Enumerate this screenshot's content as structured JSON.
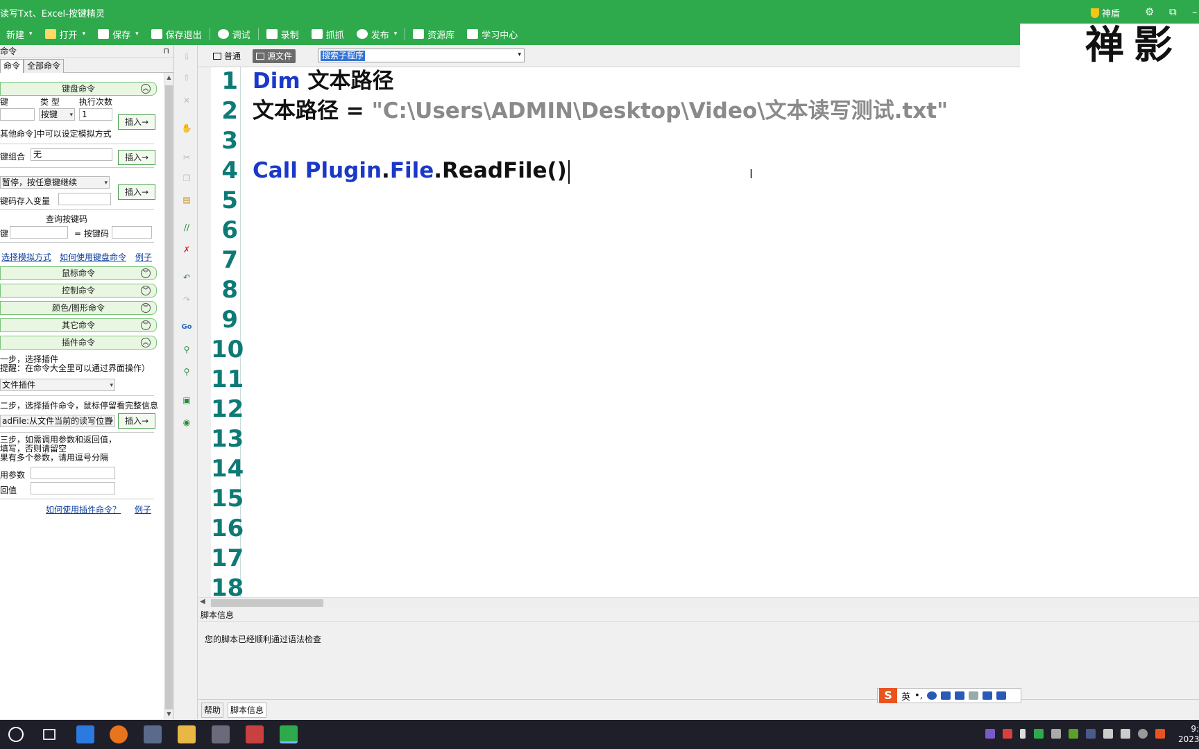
{
  "titlebar": {
    "title": "读写Txt、Excel-按键精灵",
    "shield": "神盾",
    "controls": [
      "⚙",
      "⧉",
      "–"
    ]
  },
  "toolbar": {
    "items": [
      {
        "label": "新建",
        "caret": "▾"
      },
      {
        "label": "打开",
        "caret": "▾"
      },
      {
        "label": "保存",
        "caret": "▾"
      },
      {
        "label": "保存退出"
      },
      {
        "label": "调试"
      },
      {
        "label": "录制"
      },
      {
        "label": "抓抓"
      },
      {
        "label": "发布",
        "caret": "▾"
      },
      {
        "label": "资源库"
      },
      {
        "label": "学习中心"
      }
    ]
  },
  "left": {
    "header": "命令",
    "pin": "⊓",
    "tabs": [
      "命令",
      "全部命令"
    ],
    "keyboard": {
      "title": "键盘命令",
      "col_key": "键",
      "col_type": "类 型",
      "col_count": "执行次数",
      "type_value": "按键",
      "count_value": "1",
      "insert": "插入→",
      "hint": "其他命令]中可以设定模拟方式",
      "combo_label": "键组合",
      "combo_value": "无",
      "pause_value": "暂停，按任意键继续",
      "store_label": "键码存入变量",
      "query_title": "查询按键码",
      "query_key": "键",
      "query_code": "= 按键码",
      "link1": "选择模拟方式",
      "link2": "如何使用键盘命令",
      "link3": "例子"
    },
    "sections": [
      "鼠标命令",
      "控制命令",
      "颜色/图形命令",
      "其它命令",
      "插件命令"
    ],
    "plugin": {
      "step1": "一步，选择插件",
      "step1_hint": "提醒：在命令大全里可以通过界面操作）",
      "plugin_value": "文件插件",
      "step2": "二步，选择插件命令，鼠标停留看完整信息",
      "cmd_value": "adFile:从文件当前的读写位置",
      "insert": "插入→",
      "step3a": "三步，如需调用参数和返回值，",
      "step3b": "填写，否则请留空",
      "step3c": "果有多个参数，请用逗号分隔",
      "param_label": "用参数",
      "ret_label": "回值",
      "link1": "如何使用插件命令？",
      "link2": "例子"
    }
  },
  "editor": {
    "view_normal": "普通",
    "view_source": "源文件",
    "sub_placeholder": "搜索子程序",
    "watermark": "禅影",
    "line_numbers": [
      "1",
      "2",
      "3",
      "4",
      "5",
      "6",
      "7",
      "8",
      "9",
      "10",
      "11",
      "12",
      "13",
      "14",
      "15",
      "16",
      "17",
      "18"
    ],
    "lines": [
      {
        "kw": "Dim",
        "rest": " 文本路径"
      },
      {
        "plain": "文本路径 = ",
        "str": "\"C:\\Users\\ADMIN\\Desktop\\Video\\文本读写测试.txt\""
      },
      {},
      {
        "kw": "Call",
        "kw2": "Plugin",
        "dot1": ".",
        "kw3": "File",
        "dot2": ".",
        "rest": "ReadFile()"
      }
    ],
    "ibeam": "I"
  },
  "info": {
    "header": "脚本信息",
    "message": "您的脚本已经顺利通过语法检查",
    "tabs": [
      "帮助",
      "脚本信息"
    ]
  },
  "ime": {
    "logo": "S",
    "lang": "英",
    "punct": "•,"
  },
  "taskbar": {
    "clock_time": "9:",
    "clock_date": "2023"
  }
}
